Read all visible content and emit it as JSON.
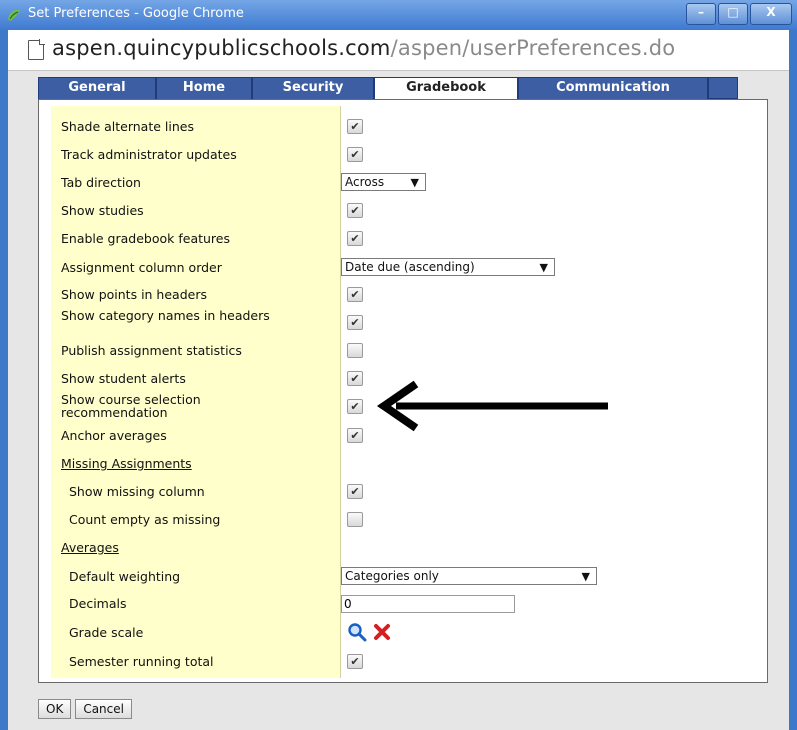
{
  "window": {
    "title": "Set Preferences - Google Chrome",
    "min_glyph": "–",
    "max_glyph": "□",
    "close_glyph": "X"
  },
  "address": {
    "host": "aspen.quincypublicschools.com",
    "path": "/aspen/userPreferences.do"
  },
  "tabs": [
    {
      "label": "General",
      "active": false
    },
    {
      "label": "Home",
      "active": false
    },
    {
      "label": "Security",
      "active": false
    },
    {
      "label": "Gradebook",
      "active": true
    },
    {
      "label": "Communication",
      "active": false
    }
  ],
  "prefs": {
    "shade": {
      "label": "Shade alternate lines",
      "checked": true
    },
    "track": {
      "label": "Track administrator updates",
      "checked": true
    },
    "tabdir": {
      "label": "Tab direction",
      "value": "Across"
    },
    "studies": {
      "label": "Show studies",
      "checked": true
    },
    "enablegb": {
      "label": "Enable gradebook features",
      "checked": true
    },
    "colorder": {
      "label": "Assignment column order",
      "value": "Date due (ascending)"
    },
    "points": {
      "label": "Show points in headers",
      "checked": true
    },
    "catnames": {
      "label": "Show category names in headers",
      "checked": true
    },
    "publish": {
      "label": "Publish assignment statistics",
      "checked": false
    },
    "alerts": {
      "label": "Show student alerts",
      "checked": true
    },
    "courserec": {
      "label": "Show course selection recommendation",
      "checked": true
    },
    "anchor": {
      "label": "Anchor averages",
      "checked": true
    },
    "missing_section": "Missing Assignments",
    "showmissing": {
      "label": "Show missing column",
      "checked": true
    },
    "countempty": {
      "label": "Count empty as missing",
      "checked": false
    },
    "averages_section": "Averages",
    "weighting": {
      "label": "Default weighting",
      "value": "Categories only"
    },
    "decimals": {
      "label": "Decimals",
      "value": "0"
    },
    "gradescale": {
      "label": "Grade scale"
    },
    "semester": {
      "label": "Semester running total",
      "checked": true
    }
  },
  "buttons": {
    "ok": "OK",
    "cancel": "Cancel"
  },
  "icons": {
    "search": "magnifier-icon",
    "remove": "red-x-icon",
    "arrow": "annotation-arrow-icon"
  }
}
